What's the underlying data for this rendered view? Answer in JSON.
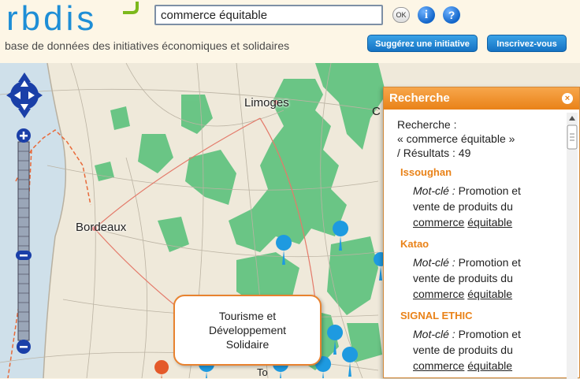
{
  "header": {
    "logo_text": "rbdis",
    "tagline": "base de données des initiatives économiques et solidaires",
    "search_value": "commerce équitable",
    "ok_label": "OK",
    "info_label": "i",
    "help_label": "?",
    "suggest_label": "Suggérez une initiative",
    "register_label": "Inscrivez-vous"
  },
  "map": {
    "cities": {
      "limoges": "Limoges",
      "bordeaux": "Bordeaux"
    },
    "edge_labels": {
      "right_c": "C",
      "bottom_to": "To"
    },
    "tooltip_lines": [
      "Tourisme et",
      "Développement",
      "Solidaire"
    ]
  },
  "panel": {
    "title": "Recherche",
    "close_label": "×",
    "summary_lines": [
      "Recherche :",
      "« commerce équitable »",
      "/ Résultats : 49"
    ],
    "results": [
      {
        "name": "Issoughan",
        "kw_label": "Mot-clé :",
        "kw_text_1": "Promotion et",
        "kw_text_2": "vente de produits du",
        "kw_word_a": "commerce",
        "kw_word_b": "équitable"
      },
      {
        "name": "Katao",
        "kw_label": "Mot-clé :",
        "kw_text_1": "Promotion et",
        "kw_text_2": "vente de produits du",
        "kw_word_a": "commerce",
        "kw_word_b": "équitable"
      },
      {
        "name": "SIGNAL ETHIC",
        "kw_label": "Mot-clé :",
        "kw_text_1": "Promotion et",
        "kw_text_2": "vente de produits du",
        "kw_word_a": "commerce",
        "kw_word_b": "équitable"
      }
    ]
  },
  "colors": {
    "accent_orange": "#e98218",
    "button_blue": "#1573c4",
    "forest_green": "#5cc27c",
    "marker_blue": "#1e9ae0"
  }
}
